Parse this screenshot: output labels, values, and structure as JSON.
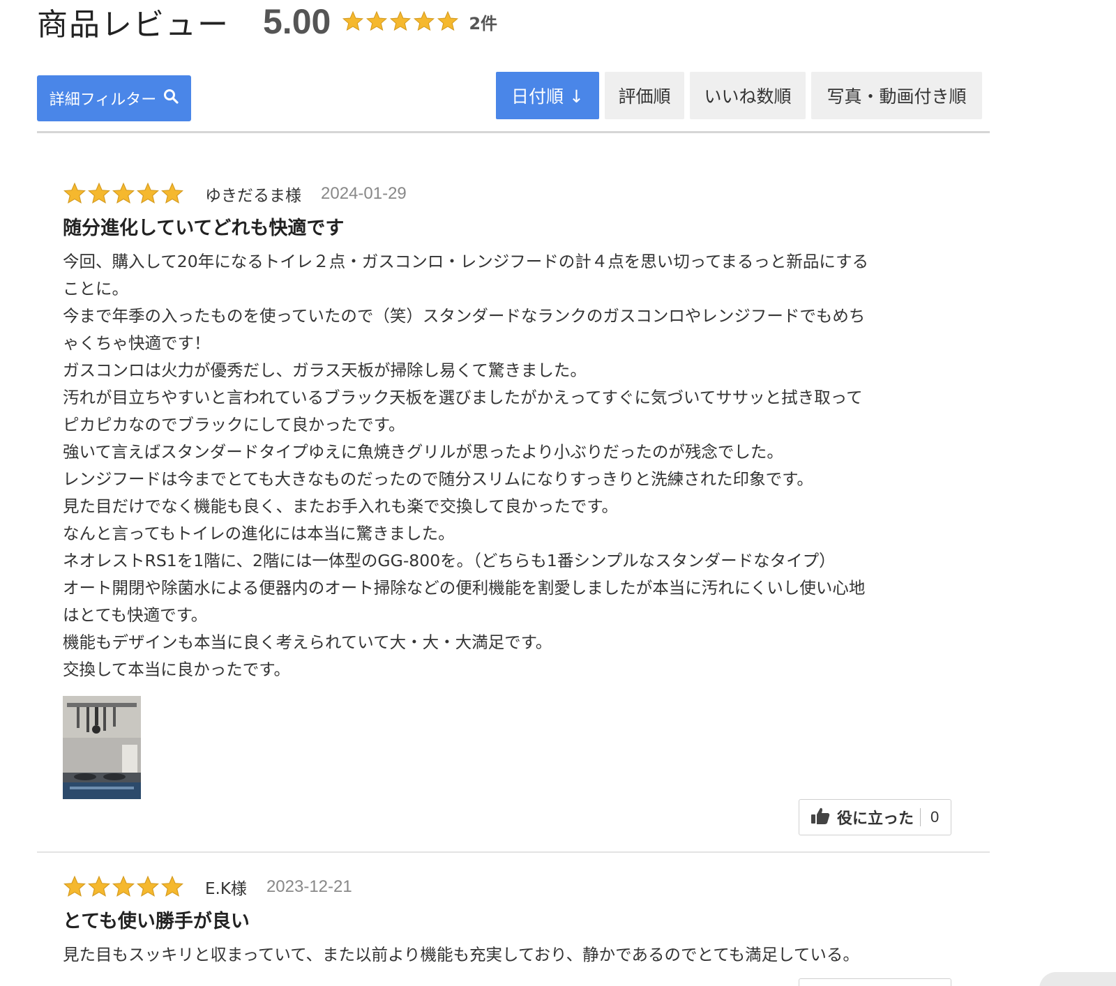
{
  "header": {
    "title": "商品レビュー",
    "average_score": "5.00",
    "average_stars": 5,
    "review_count": "2件"
  },
  "toolbar": {
    "filter_label": "詳細フィルター",
    "sort_tabs": [
      {
        "label": "日付順 ↓",
        "active": true
      },
      {
        "label": "評価順",
        "active": false
      },
      {
        "label": "いいね数順",
        "active": false
      },
      {
        "label": "写真・動画付き順",
        "active": false
      }
    ]
  },
  "reviews": [
    {
      "stars": 5,
      "author": "ゆきだるま様",
      "date": "2024-01-29",
      "title": "随分進化していてどれも快適です",
      "lines": [
        "今回、購入して20年になるトイレ２点・ガスコンロ・レンジフードの計４点を思い切ってまるっと新品にする",
        "ことに。",
        "今まで年季の入ったものを使っていたので（笑）スタンダードなランクのガスコンロやレンジフードでもめち",
        "ゃくちゃ快適です！",
        "ガスコンロは火力が優秀だし、ガラス天板が掃除し易くて驚きました。",
        "汚れが目立ちやすいと言われているブラック天板を選びましたがかえってすぐに気づいてササッと拭き取って",
        "ピカピカなのでブラックにして良かったです。",
        "強いて言えばスタンダードタイプゆえに魚焼きグリルが思ったより小ぶりだったのが残念でした。",
        "レンジフードは今までとても大きなものだったので随分スリムになりすっきりと洗練された印象です。",
        "見た目だけでなく機能も良く、またお手入れも楽で交換して良かったです。",
        "なんと言ってもトイレの進化には本当に驚きました。",
        "ネオレストRS1を1階に、2階には一体型のGG-800を。（どちらも1番シンプルなスタンダードなタイプ）",
        "オート開閉や除菌水による便器内のオート掃除などの便利機能を割愛しましたが本当に汚れにくいし使い心地",
        "はとても快適です。",
        "機能もデザインも本当に良く考えられていて大・大・大満足です。",
        "交換して本当に良かったです。"
      ],
      "has_photo": true,
      "helpful_label": "役に立った",
      "helpful_count": "0"
    },
    {
      "stars": 5,
      "author": "E.K様",
      "date": "2023-12-21",
      "title": "とても使い勝手が良い",
      "lines": [
        "見た目もスッキリと収まっていて、また以前より機能も充実しており、静かであるのでとても満足している。"
      ],
      "has_photo": false
    }
  ],
  "colors": {
    "accent": "#4a86e8",
    "star": "#f5b82e",
    "tab_bg": "#efefef"
  },
  "icons": {
    "filter": "search-icon",
    "helpful": "thumbs-up-icon",
    "rating": "star-icon"
  }
}
